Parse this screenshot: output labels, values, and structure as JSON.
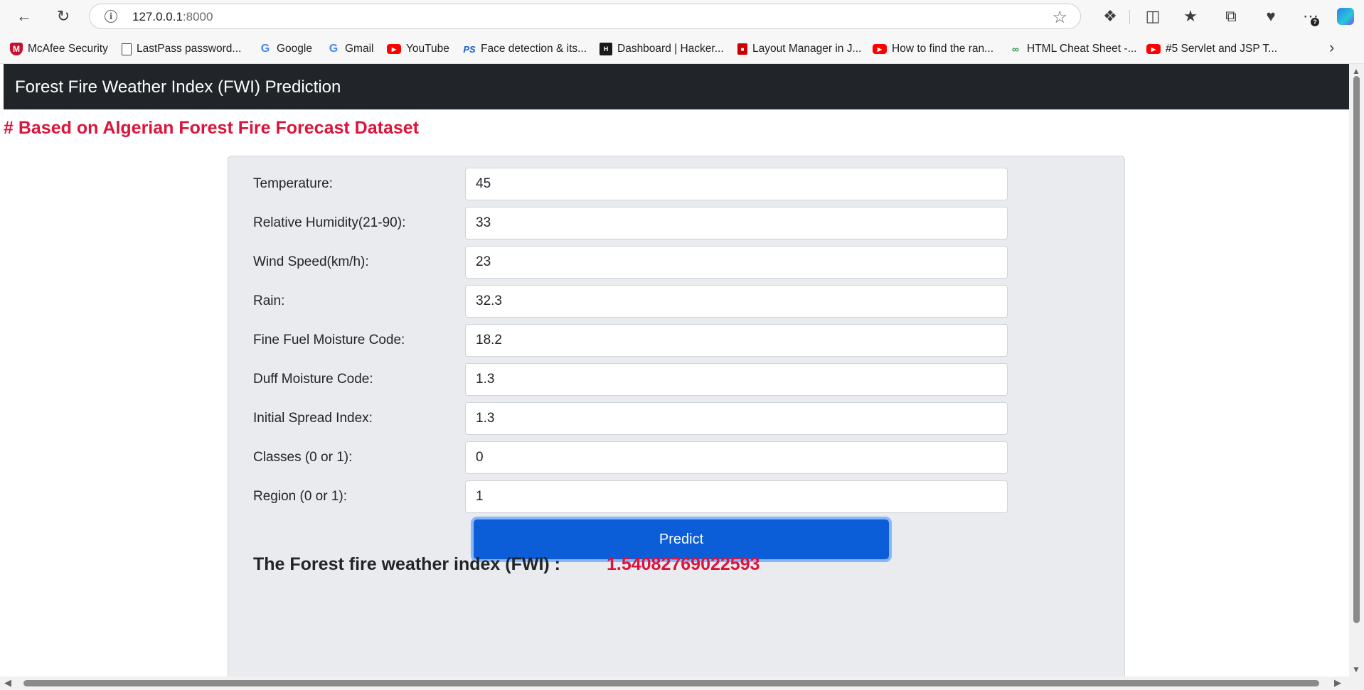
{
  "browser": {
    "url_host": "127.0.0.1",
    "url_port": ":8000",
    "bookmarks": [
      {
        "label": "McAfee Security",
        "icon": "mcafee-icon"
      },
      {
        "label": "LastPass password...",
        "icon": "page-icon"
      },
      {
        "label": "Google",
        "icon": "google-icon"
      },
      {
        "label": "Gmail",
        "icon": "google-icon"
      },
      {
        "label": "YouTube",
        "icon": "youtube-icon"
      },
      {
        "label": "Face detection & its...",
        "icon": "ps-icon"
      },
      {
        "label": "Dashboard | Hacker...",
        "icon": "hackerrank-icon"
      },
      {
        "label": "Layout Manager in J...",
        "icon": "bookmark-icon"
      },
      {
        "label": "How to find the ran...",
        "icon": "youtube-icon"
      },
      {
        "label": "HTML Cheat Sheet -...",
        "icon": "geeksforgeeks-icon"
      },
      {
        "label": "#5 Servlet and JSP T...",
        "icon": "youtube-icon"
      }
    ]
  },
  "page": {
    "navbar_title": "Forest Fire Weather Index (FWI) Prediction",
    "subtitle": "# Based on Algerian Forest Fire Forecast Dataset",
    "fields": [
      {
        "label": "Temperature:",
        "value": "45"
      },
      {
        "label": "Relative Humidity(21-90):",
        "value": "33"
      },
      {
        "label": "Wind Speed(km/h):",
        "value": "23"
      },
      {
        "label": "Rain:",
        "value": "32.3"
      },
      {
        "label": "Fine Fuel Moisture Code:",
        "value": "18.2"
      },
      {
        "label": "Duff Moisture Code:",
        "value": "1.3"
      },
      {
        "label": "Initial Spread Index:",
        "value": "1.3"
      },
      {
        "label": "Classes (0 or 1):",
        "value": "0"
      },
      {
        "label": "Region (0 or 1):",
        "value": "1"
      }
    ],
    "predict_label": "Predict",
    "result_label": "The Forest fire weather index (FWI) :",
    "result_value": "1.54082769022593"
  },
  "colors": {
    "navbar": "#212529",
    "accent_red": "#dc143c",
    "button": "#0b5ed7"
  }
}
